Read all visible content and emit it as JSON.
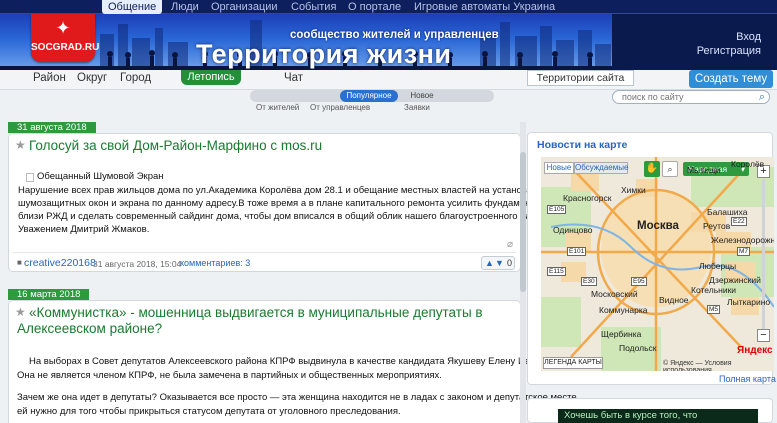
{
  "topnav": {
    "items": [
      "Общение",
      "Люди",
      "Организации",
      "События",
      "О портале",
      "Игровые автоматы Украина"
    ],
    "active_index": 0
  },
  "banner": {
    "logo_text": "SOCGRAD.RU",
    "tagline": "сообщество жителей и управленцев",
    "title": "Территория жизни",
    "login": "Вход",
    "register": "Регистрация"
  },
  "nav2": {
    "links": [
      "Район",
      "Округ",
      "Город",
      "Летопись",
      "Чат"
    ],
    "active_link": "Летопись",
    "territories": "Территории сайта",
    "create": "Создать тему"
  },
  "filter": {
    "popular": "Популярное",
    "new": "Новое",
    "from_residents": "От жителей",
    "from_officials": "От управленцев",
    "requests": "Заявки"
  },
  "search": {
    "placeholder": "поиск по сайту"
  },
  "posts": [
    {
      "date": "31 августа 2018",
      "title": "Голосуй за свой Дом-Район-Марфино с mos.ru",
      "image_alt": "Обещанный Шумовой Экран",
      "text": [
        "Нарушение всех прав жильцов дома по ул.Академика Королёва дом 28.1 и обещание местных властей на установку",
        "шумозащитных окон и экрана по данному адресу.В тоже время а в плане капитального ремонта усилить фундамент дома стоящий в",
        "близи РЖД и сделать современный сайдинг дома, чтобы дом вписался в общий облик нашего благоустроенного района.С",
        "Уважением Дмитрий Жмаков."
      ],
      "author": "creative220168",
      "timestamp": "31 августа 2018, 15:04",
      "comments_label": "комментариев: 3",
      "votes": "0"
    },
    {
      "date": "16 марта 2018",
      "title_line1": "«Коммунистка» - мошенница выдвигается в муниципальные депутаты в",
      "title_line2": "Алексеевском районе?",
      "paragraph1": [
        "На выборах в Совет депутатов Алексеевского района КПРФ выдвинула в качестве кандидата Якушеву Елену Ивановну.",
        "Она не является членом КПРФ, не была замечена в партийных и общественных мероприятиях."
      ],
      "paragraph2": [
        "Зачем же она идет в депутаты? Оказывается все просто — эта женщина находится не в ладах с законом и депутатское месте",
        "ей нужно для того чтобы прикрыться статусом депутата от уголовного преследования."
      ]
    }
  ],
  "map": {
    "heading": "Новости на карте",
    "tabs": [
      "Новые",
      "Обсуждаемые"
    ],
    "map_type": "Народная",
    "cities": [
      "Красногорск",
      "Химки",
      "Мытищи",
      "Королёв",
      "Балашиха",
      "Реутов",
      "Железнодорожный",
      "Москва",
      "Люберцы",
      "Одинцово",
      "Дзержинский",
      "Котельники",
      "Лыткарино",
      "Московский",
      "Видное",
      "Коммунарка",
      "Щербинка",
      "Подольск"
    ],
    "roads": [
      "E105",
      "E101",
      "E115",
      "E30",
      "E22",
      "M7",
      "E95",
      "M5"
    ],
    "legend": "ЛЕГЕНДА КАРТЫ",
    "brand": "Яндекс",
    "copyright": "© Яндекс — Условия использования",
    "full_map": "Полная карта"
  },
  "promo": {
    "text": "Хочешь быть в курсе того, что"
  }
}
